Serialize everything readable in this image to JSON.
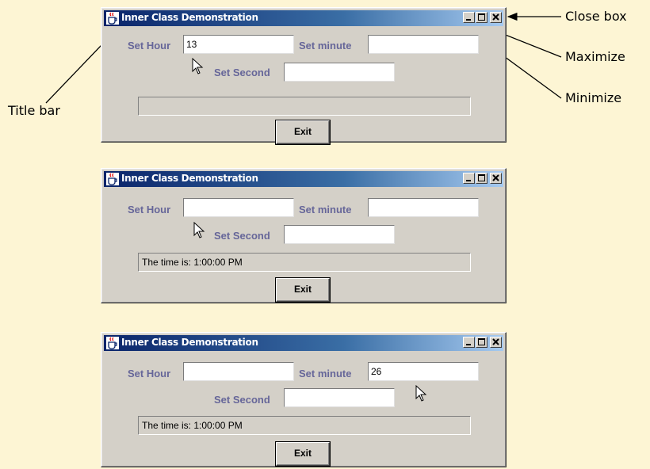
{
  "window_title": "Inner Class Demonstration",
  "labels": {
    "hour": "Set Hour",
    "minute": "Set minute",
    "second": "Set Second",
    "exit": "Exit"
  },
  "windows": [
    {
      "hour_value": "13",
      "minute_value": "",
      "second_value": "",
      "output_text": ""
    },
    {
      "hour_value": "",
      "minute_value": "",
      "second_value": "",
      "output_text": "The time is: 1:00:00 PM"
    },
    {
      "hour_value": "",
      "minute_value": "26",
      "second_value": "",
      "output_text": "The time is: 1:00:00 PM"
    }
  ],
  "callouts": {
    "close_box": "Close box",
    "maximize": "Maximize",
    "minimize": "Minimize",
    "title_bar": "Title bar"
  },
  "colors": {
    "background": "#fdf5d4",
    "label": "#666699",
    "titlebar_start": "#0a246a",
    "titlebar_end": "#a6caf0"
  },
  "icons": [
    "java-cup-icon",
    "minimize-icon",
    "maximize-icon",
    "close-icon",
    "mouse-cursor-icon"
  ]
}
